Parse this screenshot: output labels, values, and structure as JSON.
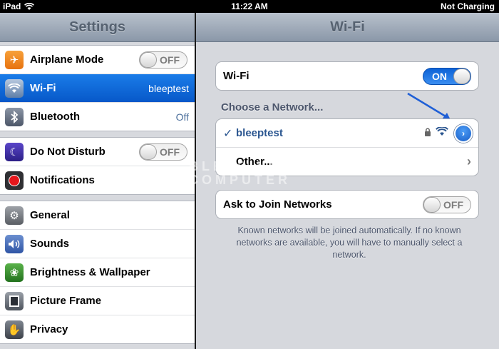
{
  "status_bar": {
    "device": "iPad",
    "time": "11:22 AM",
    "battery": "Not Charging"
  },
  "sidebar": {
    "title": "Settings",
    "groups": [
      [
        {
          "label": "Airplane Mode",
          "icon": "airplane-icon",
          "toggle": "OFF"
        },
        {
          "label": "Wi-Fi",
          "icon": "wifi-icon",
          "value": "bleeptest",
          "selected": true
        },
        {
          "label": "Bluetooth",
          "icon": "bluetooth-icon",
          "value": "Off"
        }
      ],
      [
        {
          "label": "Do Not Disturb",
          "icon": "moon-icon",
          "toggle": "OFF"
        },
        {
          "label": "Notifications",
          "icon": "notifications-icon"
        }
      ],
      [
        {
          "label": "General",
          "icon": "gear-icon"
        },
        {
          "label": "Sounds",
          "icon": "speaker-icon"
        },
        {
          "label": "Brightness & Wallpaper",
          "icon": "flower-icon"
        },
        {
          "label": "Picture Frame",
          "icon": "picture-frame-icon"
        },
        {
          "label": "Privacy",
          "icon": "hand-icon"
        }
      ]
    ]
  },
  "detail": {
    "title": "Wi-Fi",
    "wifi_toggle_label": "Wi-Fi",
    "wifi_toggle_value": "ON",
    "choose_network": "Choose a Network...",
    "networks": [
      {
        "name": "bleeptest",
        "checked": "✓"
      },
      {
        "name": "Other..."
      }
    ],
    "ask_to_join_label": "Ask to Join Networks",
    "ask_to_join_value": "OFF",
    "footnote": "Known networks will be joined automatically. If no known networks are available, you will have to manually select a network."
  },
  "watermark": {
    "line1": "BLEEPING",
    "line2": "COMPUTER"
  },
  "colors": {
    "selection_blue": "#0a63d6",
    "sidebar_bg": "#d7d9de",
    "link_blue": "#2b5690"
  }
}
